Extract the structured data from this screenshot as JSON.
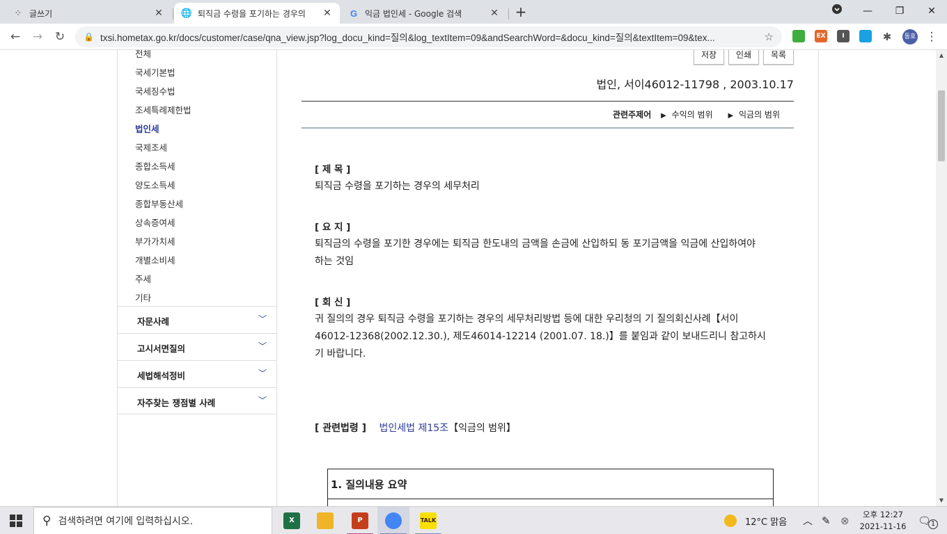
{
  "browser": {
    "tabs": [
      {
        "title": "글쓰기",
        "icon": "blog-icon",
        "active": false
      },
      {
        "title": "퇴직금 수령을 포기하는 경우의",
        "icon": "globe-icon",
        "active": true
      },
      {
        "title": "익금 법인세 - Google 검색",
        "icon": "google-icon",
        "active": false
      }
    ],
    "new_tab_symbol": "+",
    "url": "txsi.hometax.go.kr/docs/customer/case/qna_view.jsp?log_docu_kind=질의&log_textItem=09&andSearchWord=&docu_kind=질의&textItem=09&tex...",
    "extensions": [
      {
        "label": "",
        "color": "#3fae3f"
      },
      {
        "label": "EX",
        "color": "#e3672a"
      },
      {
        "label": "I",
        "color": "#555555"
      },
      {
        "label": "",
        "color": "#1aa1e1"
      }
    ],
    "profile_label": "동호"
  },
  "sidebar": {
    "items": [
      "전체",
      "국세기본법",
      "국세징수법",
      "조세특례제한법",
      "법인세",
      "국제조세",
      "종합소득세",
      "양도소득세",
      "종합부동산세",
      "상속증여세",
      "부가가치세",
      "개별소비세",
      "주세",
      "기타"
    ],
    "active_item": "법인세",
    "groups": [
      "자문사례",
      "고시서면질의",
      "세법해석정비",
      "자주찾는 쟁점별 사례"
    ]
  },
  "doc": {
    "buttons": {
      "save": "저장",
      "print": "인쇄",
      "list": "목록"
    },
    "reference": "법인, 서이46012-11798 , 2003.10.17",
    "related_topic_label": "관련주제어",
    "related_topics": [
      "수익의 범위",
      "익금의 범위"
    ],
    "sections": [
      {
        "head": "[ 제 목 ]",
        "text": "퇴직금 수령을 포기하는 경우의 세무처리"
      },
      {
        "head": "[ 요 지 ]",
        "text": "퇴직금의 수령을 포기한 경우에는 퇴직금 한도내의 금액을 손금에 산입하되 동 포기금액을 익금에 산입하여야 하는 것임"
      },
      {
        "head": "[ 회 신 ]",
        "text": "귀 질의의 경우 퇴직금 수령을 포기하는 경우의 세무처리방법 등에 대한 우리청의 기 질의회신사례【서이46012-12368(2002.12.30.), 제도46014-12214 (2001.07. 18.)】를 붙임과 같이 보내드리니 참고하시기 바랍니다."
      }
    ],
    "law_label": "[ 관련법령 ]",
    "law_link": "법인세법 제15조",
    "law_suffix": "【익금의 범위】",
    "summary_header": "1. 질의내용 요약"
  },
  "taskbar": {
    "search_placeholder": "검색하려면 여기에 입력하십시오.",
    "apps": [
      {
        "name": "excel",
        "label": "X",
        "color": "#1e7145"
      },
      {
        "name": "file-explorer",
        "label": "",
        "color": "#f0b429"
      },
      {
        "name": "powerpoint",
        "label": "P",
        "color": "#c43e1c"
      },
      {
        "name": "chrome",
        "label": "",
        "color": "#4285f4"
      },
      {
        "name": "kakaotalk",
        "label": "TALK",
        "color": "#f9e000"
      }
    ],
    "weather": "12°C  맑음",
    "time": "오후 12:27",
    "date": "2021-11-16",
    "notification_count": "1"
  }
}
